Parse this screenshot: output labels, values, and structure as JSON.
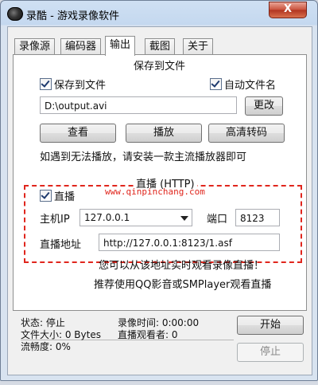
{
  "window": {
    "title": "录酷 - 游戏录像软件",
    "close_label": "X"
  },
  "tabs": [
    "录像源",
    "编码器",
    "输出",
    "截图",
    "关于"
  ],
  "active_tab": "输出",
  "save_group": {
    "title": "保存到文件",
    "save_to_file_label": "保存到文件",
    "auto_filename_label": "自动文件名",
    "path_value": "D:\\output.avi",
    "change_button": "更改",
    "view_button": "查看",
    "play_button": "播放",
    "hd_convert_button": "高清转码",
    "hint": "如遇到无法播放，请安装一款主流播放器即可"
  },
  "live_group": {
    "title": "直播 (HTTP)",
    "live_label": "直播",
    "watermark": "www.qinpinchang.com",
    "host_label": "主机IP",
    "host_value": "127.0.0.1",
    "port_label": "端口",
    "port_value": "8123",
    "address_label": "直播地址",
    "address_value": "http://127.0.0.1:8123/1.asf",
    "info1": "您可以从该地址实时观看录像直播！",
    "info2": "推荐使用QQ影音或SMPlayer观看直播"
  },
  "status": {
    "state": "状态: 停止",
    "record_time": "录像时间: 0:00:00",
    "file_size": "文件大小: 0 Bytes",
    "viewers": "直播观看者: 0",
    "fluency": "流畅度: 0%"
  },
  "buttons": {
    "start": "开始",
    "stop": "停止"
  },
  "colors": {
    "accent_red": "#e0261d"
  }
}
